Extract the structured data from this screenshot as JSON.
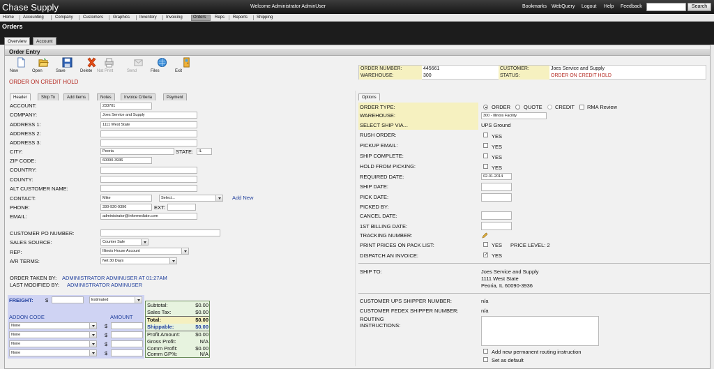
{
  "app": {
    "title": "Chase Supply",
    "welcome": "Welcome  Administrator AdminUser"
  },
  "top_links": {
    "bookmarks": "Bookmarks",
    "webquery": "WebQuery",
    "logout": "Logout",
    "help": "Help",
    "feedback": "Feedback",
    "search_button": "Search"
  },
  "nav": {
    "items": [
      "Home",
      "Accounting",
      "Company",
      "Customers",
      "Graphics",
      "Inventory",
      "Invoicing",
      "Orders",
      "Reps",
      "Reports",
      "Shipping"
    ]
  },
  "page": {
    "title": "Orders"
  },
  "main_tabs": [
    "Overview",
    "Account"
  ],
  "order_entry": {
    "title": "Order Entry"
  },
  "toolbar": {
    "new": "New",
    "open": "Open",
    "save": "Save",
    "delete": "Delete",
    "nat": "Nat",
    "print": "Print",
    "send": "Send",
    "files": "Files",
    "exit": "Exit"
  },
  "status_banner": "ORDER ON CREDIT HOLD",
  "summary": {
    "order_number_label": "ORDER NUMBER:",
    "order_number": "445661",
    "customer_label": "CUSTOMER:",
    "customer": "Joes Service and Supply",
    "warehouse_label": "WAREHOUSE:",
    "warehouse": "300",
    "status_label": "STATUS:",
    "status": "ORDER ON CREDIT HOLD"
  },
  "left_tabs": [
    "Header",
    "Ship To",
    "Add Items",
    "Notes",
    "Invoice Criteria",
    "Payment"
  ],
  "right_tabs": [
    "Options"
  ],
  "header_form": {
    "account_label": "ACCOUNT:",
    "account": "233701",
    "company_label": "COMPANY:",
    "company": "Joes Service and Supply",
    "address1_label": "ADDRESS 1:",
    "address1": "1111 West State",
    "address2_label": "ADDRESS 2:",
    "address2": "",
    "address3_label": "ADDRESS 3:",
    "address3": "",
    "city_label": "CITY:",
    "city": "Peoria",
    "state_label": "STATE:",
    "state": "IL",
    "zip_label": "ZIP CODE:",
    "zip": "60090-3936",
    "country_label": "COUNTRY:",
    "country": "",
    "county_label": "COUNTY:",
    "county": "",
    "alt_label": "ALT CUSTOMER NAME:",
    "alt": "",
    "contact_label": "CONTACT:",
    "contact": "Mike",
    "contact_select": "Select...",
    "add_new": "Add New",
    "phone_label": "PHONE:",
    "phone": "330-920-9396",
    "ext_label": "EXT:",
    "ext": "",
    "email_label": "EMAIL:",
    "email": "administrator@informediate.com",
    "po_label": "CUSTOMER PO NUMBER:",
    "po": "",
    "sales_source_label": "SALES SOURCE:",
    "sales_source": "Counter Sale",
    "rep_label": "REP:",
    "rep": "Illinois House Account",
    "terms_label": "A/R TERMS:",
    "terms": "Net 30 Days",
    "taken_by_label": "ORDER TAKEN BY:",
    "taken_by": "ADMINISTRATOR ADMINUSER AT 01:27AM",
    "modified_by_label": "LAST MODIFIED BY:",
    "modified_by": "ADMINISTRATOR ADMINUSER"
  },
  "freight": {
    "label": "FREIGHT:",
    "currency": "$",
    "value": "",
    "type": "Estimated",
    "addon_code_label": "ADDON CODE",
    "amount_label": "AMOUNT",
    "addons": [
      {
        "code": "None",
        "currency": "$",
        "amount": ""
      },
      {
        "code": "None",
        "currency": "$",
        "amount": ""
      },
      {
        "code": "None",
        "currency": "$",
        "amount": ""
      },
      {
        "code": "None",
        "currency": "$",
        "amount": ""
      }
    ]
  },
  "totals": [
    {
      "label": "Subtotal:",
      "value": "$0.00"
    },
    {
      "label": "Sales Tax:",
      "value": "$0.00"
    },
    {
      "label": "Total:",
      "value": "$0.00"
    },
    {
      "label": "Shippable:",
      "value": "$0.00"
    },
    {
      "label": "Profit Amount:",
      "value": "$0.00"
    },
    {
      "label": "Gross Profit:",
      "value": "N/A"
    },
    {
      "label": "Comm Profit:",
      "value": "$0.00"
    },
    {
      "label": "Comm GP%:",
      "value": "N/A"
    }
  ],
  "options": {
    "order_type_label": "ORDER TYPE:",
    "type_order": "ORDER",
    "type_quote": "QUOTE",
    "type_credit": "CREDIT",
    "rma": "RMA Review",
    "warehouse_label": "WAREHOUSE:",
    "warehouse": "300 - Illinois Facility",
    "ship_via_label": "SELECT SHIP VIA...",
    "ship_via": "UPS Ground",
    "rush_label": "RUSH ORDER:",
    "pickup_label": "PICKUP EMAIL:",
    "ship_complete_label": "SHIP COMPLETE:",
    "hold_label": "HOLD FROM PICKING:",
    "yes": "YES",
    "required_date_label": "REQUIRED DATE:",
    "required_date": "02-01-2014",
    "ship_date_label": "SHIP DATE:",
    "pick_date_label": "PICK DATE:",
    "picked_by_label": "PICKED BY:",
    "cancel_date_label": "CANCEL DATE:",
    "billing_date_label": "1ST BILLING DATE:",
    "tracking_label": "TRACKING NUMBER:",
    "print_prices_label": "PRINT PRICES ON PACK LIST:",
    "price_level": "PRICE LEVEL: 2",
    "dispatch_label": "DISPATCH AN INVOICE:",
    "ship_to_label": "SHIP TO:",
    "ship_to_name": "Joes Service and Supply",
    "ship_to_street": "1111 West State",
    "ship_to_city": "Peoria, IL 60090-3936",
    "ups_label": "CUSTOMER UPS SHIPPER NUMBER:",
    "ups": "n/a",
    "fedex_label": "CUSTOMER FEDEX SHIPPER NUMBER:",
    "fedex": "n/a",
    "routing_label_1": "ROUTING",
    "routing_label_2": "INSTRUCTIONS:",
    "add_routing": "Add new permanent routing instruction",
    "set_default": "Set as default"
  }
}
